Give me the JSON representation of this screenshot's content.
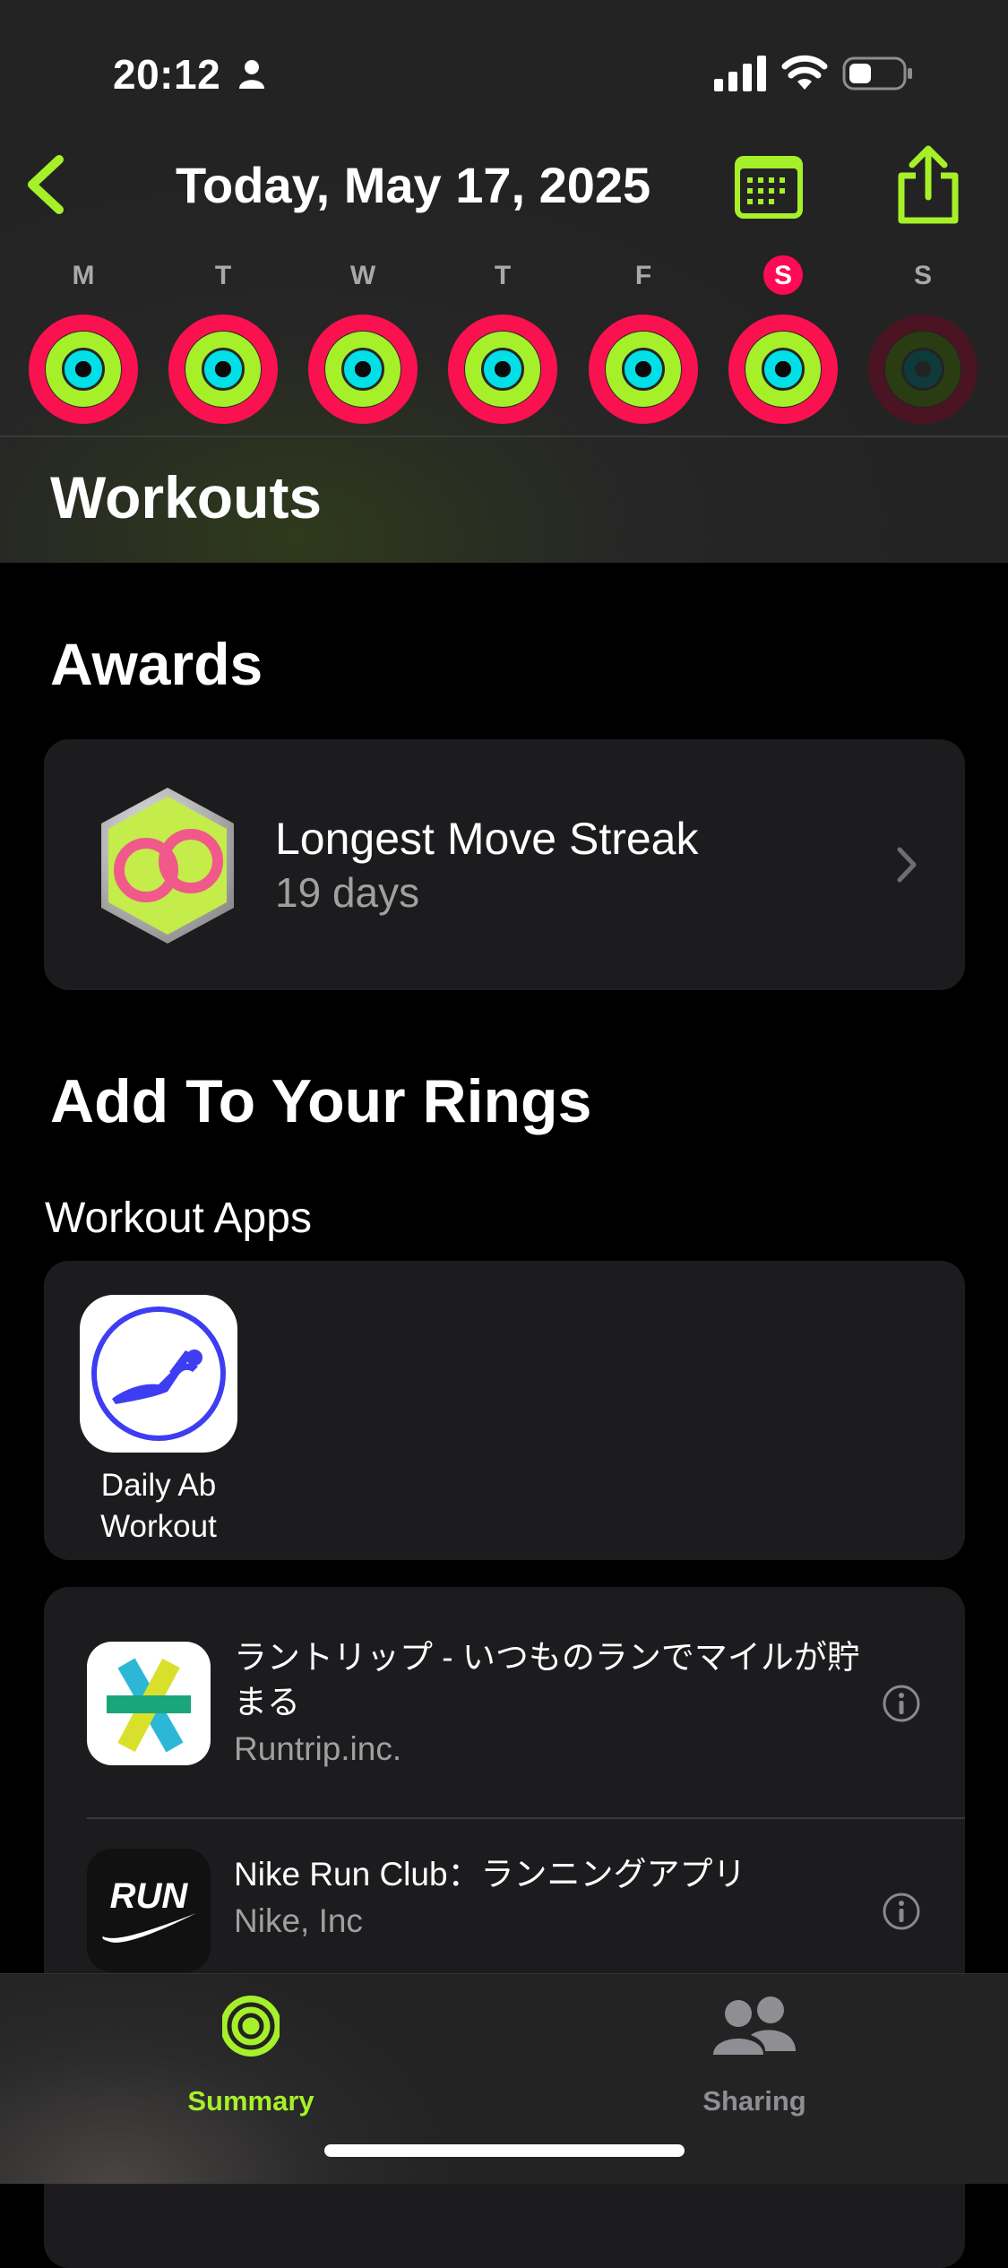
{
  "status_bar": {
    "time": "20:12",
    "icons": [
      "person-icon",
      "cellular-signal-icon",
      "wifi-icon",
      "battery-icon"
    ]
  },
  "nav": {
    "title": "Today, May 17, 2025",
    "back_icon": "chevron-left-icon",
    "calendar_icon": "calendar-icon",
    "share_icon": "share-icon",
    "accent_color": "#a6f02a"
  },
  "week": {
    "days": [
      {
        "letter": "M",
        "selected": false
      },
      {
        "letter": "T",
        "selected": false
      },
      {
        "letter": "W",
        "selected": false
      },
      {
        "letter": "T",
        "selected": false
      },
      {
        "letter": "F",
        "selected": false
      },
      {
        "letter": "S",
        "selected": true
      },
      {
        "letter": "S",
        "selected": false
      }
    ],
    "ring_colors": {
      "move": "#fa114f",
      "exercise": "#a6f02a",
      "stand": "#00e0e6"
    }
  },
  "sections": {
    "workouts": "Workouts",
    "awards": "Awards",
    "add_rings": "Add To Your Rings",
    "workout_apps": "Workout Apps"
  },
  "award": {
    "title": "Longest Move Streak",
    "subtitle": "19 days",
    "icon": "move-streak-badge-icon"
  },
  "apps": [
    {
      "name": "Daily Ab Workout",
      "icon": "daily-ab-workout-icon"
    }
  ],
  "list": [
    {
      "title": "ラントリップ - いつものランでマイルが貯まる",
      "subtitle": "Runtrip.inc.",
      "icon": "runtrip-app-icon"
    },
    {
      "title": "Nike Run Club：ランニングアプリ",
      "subtitle": "Nike, Inc",
      "icon": "nike-run-club-icon",
      "icon_text": "RUN"
    }
  ],
  "tabs": [
    {
      "label": "Summary",
      "icon": "summary-rings-icon",
      "active": true
    },
    {
      "label": "Sharing",
      "icon": "sharing-people-icon",
      "active": false
    }
  ]
}
